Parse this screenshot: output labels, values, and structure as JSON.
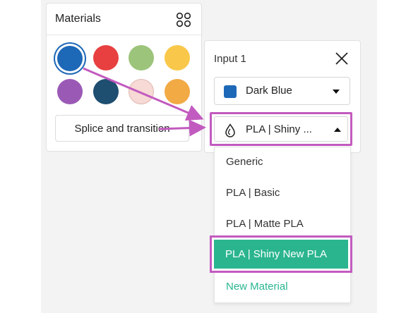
{
  "materials_panel": {
    "title": "Materials",
    "swatches": [
      {
        "color": "#1e68b8",
        "selected": true
      },
      {
        "color": "#e84040"
      },
      {
        "color": "#9cc47a"
      },
      {
        "color": "#f9c84a"
      },
      {
        "color": "#9b59b6"
      },
      {
        "color": "#1e4e70"
      },
      {
        "color": "#f7d9d5"
      },
      {
        "color": "#f2aa45"
      }
    ],
    "splice_label": "Splice and transition"
  },
  "input_panel": {
    "title": "Input 1",
    "color_select": {
      "value": "Dark Blue",
      "chip_color": "#1e68b8"
    },
    "material_select": {
      "value": "PLA | Shiny ..."
    }
  },
  "dropdown": {
    "items": [
      {
        "label": "Generic"
      },
      {
        "label": "PLA | Basic"
      },
      {
        "label": "PLA | Matte PLA"
      },
      {
        "label": "PLA | Shiny New PLA",
        "highlighted": true
      },
      {
        "label": "New Material"
      }
    ]
  },
  "colors": {
    "accent_green": "#2ab58f",
    "annotation_magenta": "#c25bbf"
  }
}
